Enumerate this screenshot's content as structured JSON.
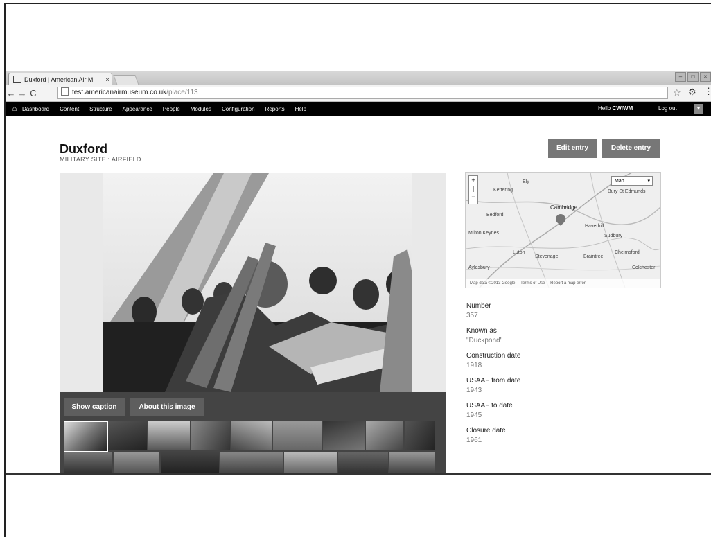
{
  "browser": {
    "tab_title": "Duxford | American Air M",
    "tab_close": "×",
    "url_host": "test.americanairmuseum.co.uk",
    "url_path": "/place/113",
    "back": "←",
    "forward": "→",
    "reload": "C"
  },
  "toolbar": {
    "items": [
      "Dashboard",
      "Content",
      "Structure",
      "Appearance",
      "People",
      "Modules",
      "Configuration",
      "Reports",
      "Help"
    ],
    "hello_prefix": "Hello",
    "hello_user": "CWIWM",
    "logout": "Log out"
  },
  "page": {
    "title": "Duxford",
    "subtitle": "MILITARY SITE : AIRFIELD",
    "edit_button": "Edit entry",
    "delete_button": "Delete entry"
  },
  "media": {
    "show_caption": "Show caption",
    "about_image": "About this image"
  },
  "map": {
    "labels": [
      "Ely",
      "Kettering",
      "Cambridge",
      "Bury St Edmunds",
      "Bedford",
      "Haverhill",
      "Milton Keynes",
      "Sudbury",
      "Stevenage",
      "Luton",
      "Braintree",
      "Chelmsford",
      "Aylesbury",
      "Colchester"
    ],
    "maptype": "Map",
    "footer_data": "Map data ©2013 Google",
    "footer_terms": "Terms of Use",
    "footer_report": "Report a map error"
  },
  "details": [
    {
      "label": "Number",
      "value": "357"
    },
    {
      "label": "Known as",
      "value": "\"Duckpond\""
    },
    {
      "label": "Construction date",
      "value": "1918"
    },
    {
      "label": "USAAF from date",
      "value": "1943"
    },
    {
      "label": "USAAF to date",
      "value": "1945"
    },
    {
      "label": "Closure date",
      "value": "1961"
    }
  ]
}
